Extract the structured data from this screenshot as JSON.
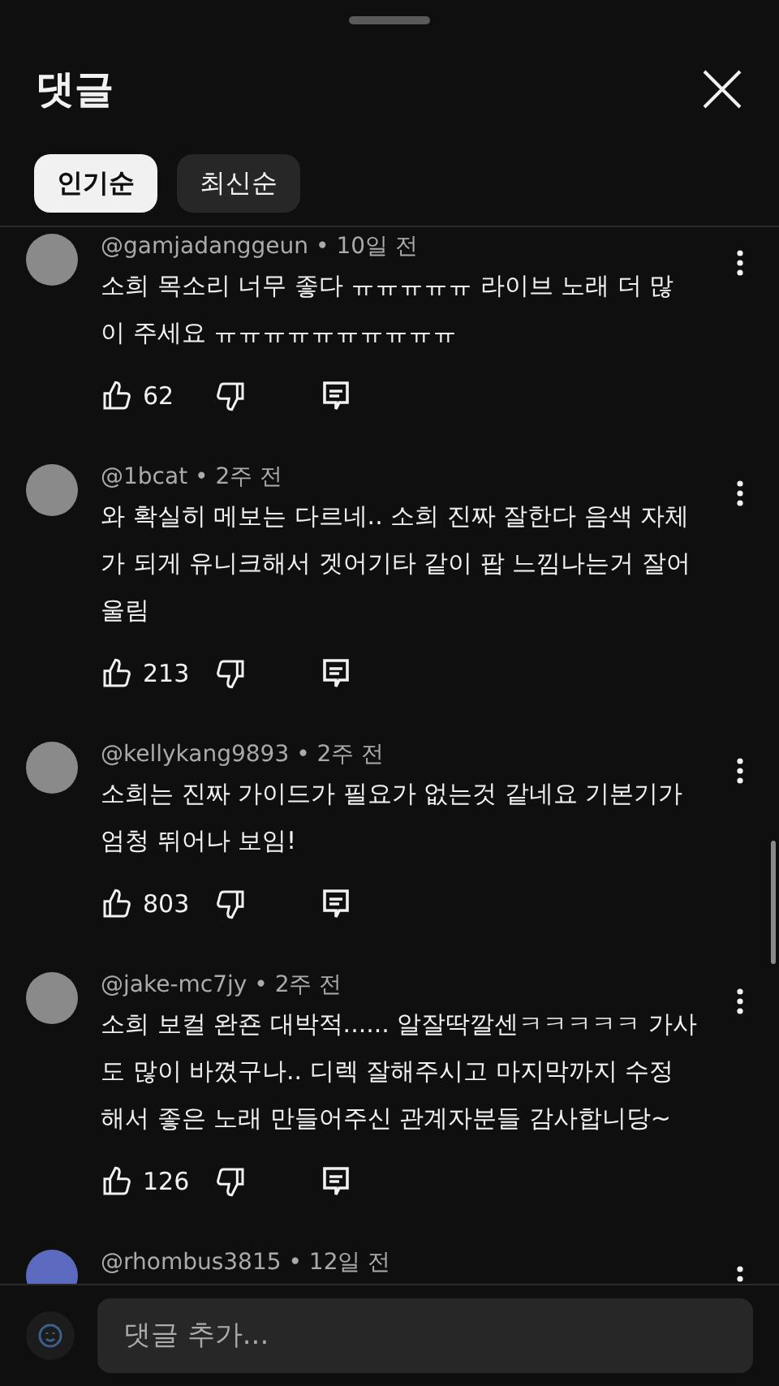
{
  "header": {
    "title": "댓글"
  },
  "sort_chips": [
    {
      "label": "인기순",
      "selected": true
    },
    {
      "label": "최신순",
      "selected": false
    }
  ],
  "comments": [
    {
      "kind": "photo",
      "byline": "@gamjadanggeun • 10일 전",
      "text": "소희 목소리 너무 좋다 ㅠㅠㅠㅠㅠ 라이브 노래 더 많이 주세요 ㅠㅠㅠㅠㅠㅠㅠㅠㅠㅠ",
      "likes": "62"
    },
    {
      "kind": "photo",
      "byline": "@1bcat • 2주 전",
      "text": "와 확실히 메보는 다르네.. 소희 진짜 잘한다 음색 자체가 되게 유니크해서 겟어기타 같이 팝 느낌나는거 잘어울림",
      "likes": "213"
    },
    {
      "kind": "photo",
      "byline": "@kellykang9893 • 2주 전",
      "text": "소희는 진짜 가이드가 필요가 없는것 같네요 기본기가 엄청 뛰어나 보임!",
      "likes": "803"
    },
    {
      "kind": "photo",
      "byline": "@jake-mc7jy • 2주 전",
      "text": "소희 보컬 완죤 대박적...... 알잘딱깔센ㅋㅋㅋㅋㅋ 가사도 많이 바꼈구나.. 디렉 잘해주시고 마지막까지 수정해서 좋은 노래 만들어주신 관계자분들 감사합니당~",
      "likes": "126"
    },
    {
      "kind": "default",
      "byline": "@rhombus3815 • 12일 전"
    }
  ],
  "composer": {
    "placeholder": "댓글 추가..."
  }
}
